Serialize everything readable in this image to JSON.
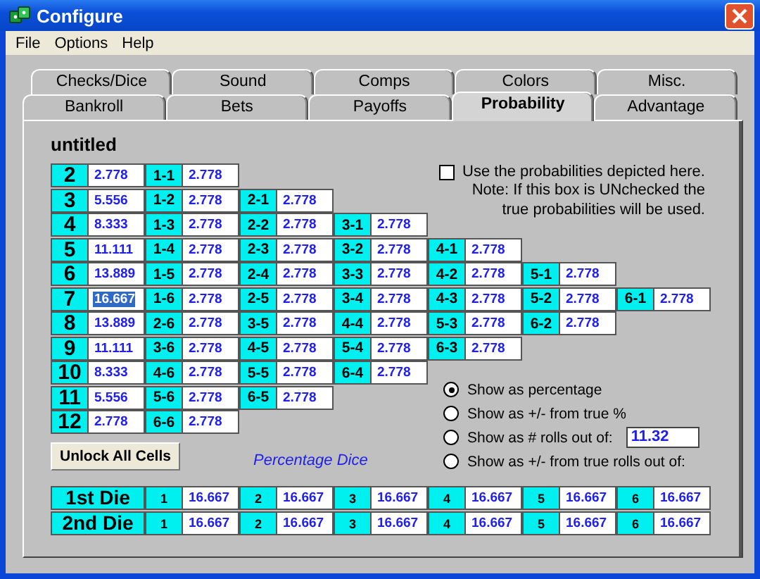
{
  "window": {
    "title": "Configure"
  },
  "menu": [
    "File",
    "Options",
    "Help"
  ],
  "tab_rows": [
    {
      "tabs": [
        {
          "label": "Checks/Dice",
          "selected": false
        },
        {
          "label": "Sound",
          "selected": false
        },
        {
          "label": "Comps",
          "selected": false
        },
        {
          "label": "Colors",
          "selected": false
        },
        {
          "label": "Misc.",
          "selected": false
        }
      ]
    },
    {
      "tabs": [
        {
          "label": "Bankroll",
          "selected": false
        },
        {
          "label": "Bets",
          "selected": false
        },
        {
          "label": "Payoffs",
          "selected": false
        },
        {
          "label": "Probability",
          "selected": true
        },
        {
          "label": "Advantage",
          "selected": false
        }
      ]
    }
  ],
  "document_title": "untitled",
  "use_probabilities": {
    "label": "Use the probabilities depicted here.",
    "checked": false,
    "note": "Note:  If this box is UNchecked the true probabilities will be used."
  },
  "sums": [
    {
      "total": "2",
      "value": "2.778",
      "selected": false,
      "combos": [
        {
          "label": "1-1",
          "value": "2.778"
        }
      ]
    },
    {
      "total": "3",
      "value": "5.556",
      "selected": false,
      "combos": [
        {
          "label": "1-2",
          "value": "2.778"
        },
        {
          "label": "2-1",
          "value": "2.778"
        }
      ]
    },
    {
      "total": "4",
      "value": "8.333",
      "selected": false,
      "combos": [
        {
          "label": "1-3",
          "value": "2.778"
        },
        {
          "label": "2-2",
          "value": "2.778"
        },
        {
          "label": "3-1",
          "value": "2.778"
        }
      ]
    },
    {
      "total": "5",
      "value": "11.111",
      "selected": false,
      "combos": [
        {
          "label": "1-4",
          "value": "2.778"
        },
        {
          "label": "2-3",
          "value": "2.778"
        },
        {
          "label": "3-2",
          "value": "2.778"
        },
        {
          "label": "4-1",
          "value": "2.778"
        }
      ]
    },
    {
      "total": "6",
      "value": "13.889",
      "selected": false,
      "combos": [
        {
          "label": "1-5",
          "value": "2.778"
        },
        {
          "label": "2-4",
          "value": "2.778"
        },
        {
          "label": "3-3",
          "value": "2.778"
        },
        {
          "label": "4-2",
          "value": "2.778"
        },
        {
          "label": "5-1",
          "value": "2.778"
        }
      ]
    },
    {
      "total": "7",
      "value": "16.667",
      "selected": true,
      "combos": [
        {
          "label": "1-6",
          "value": "2.778"
        },
        {
          "label": "2-5",
          "value": "2.778"
        },
        {
          "label": "3-4",
          "value": "2.778"
        },
        {
          "label": "4-3",
          "value": "2.778"
        },
        {
          "label": "5-2",
          "value": "2.778"
        },
        {
          "label": "6-1",
          "value": "2.778"
        }
      ]
    },
    {
      "total": "8",
      "value": "13.889",
      "selected": false,
      "combos": [
        {
          "label": "2-6",
          "value": "2.778"
        },
        {
          "label": "3-5",
          "value": "2.778"
        },
        {
          "label": "4-4",
          "value": "2.778"
        },
        {
          "label": "5-3",
          "value": "2.778"
        },
        {
          "label": "6-2",
          "value": "2.778"
        }
      ]
    },
    {
      "total": "9",
      "value": "11.111",
      "selected": false,
      "combos": [
        {
          "label": "3-6",
          "value": "2.778"
        },
        {
          "label": "4-5",
          "value": "2.778"
        },
        {
          "label": "5-4",
          "value": "2.778"
        },
        {
          "label": "6-3",
          "value": "2.778"
        }
      ]
    },
    {
      "total": "10",
      "value": "8.333",
      "selected": false,
      "combos": [
        {
          "label": "4-6",
          "value": "2.778"
        },
        {
          "label": "5-5",
          "value": "2.778"
        },
        {
          "label": "6-4",
          "value": "2.778"
        }
      ]
    },
    {
      "total": "11",
      "value": "5.556",
      "selected": false,
      "combos": [
        {
          "label": "5-6",
          "value": "2.778"
        },
        {
          "label": "6-5",
          "value": "2.778"
        }
      ]
    },
    {
      "total": "12",
      "value": "2.778",
      "selected": false,
      "combos": [
        {
          "label": "6-6",
          "value": "2.778"
        }
      ]
    }
  ],
  "unlock_button": "Unlock All Cells",
  "dice_caption": "Percentage Dice",
  "display_options": [
    {
      "label": "Show as percentage",
      "selected": true
    },
    {
      "label": "Show as +/- from true %",
      "selected": false
    },
    {
      "label": "Show as # rolls out of:",
      "selected": false,
      "field": "11.32"
    },
    {
      "label": "Show as +/- from true rolls out of:",
      "selected": false
    }
  ],
  "dice": [
    {
      "label": "1st Die",
      "faces": [
        {
          "label": "1",
          "value": "16.667"
        },
        {
          "label": "2",
          "value": "16.667"
        },
        {
          "label": "3",
          "value": "16.667"
        },
        {
          "label": "4",
          "value": "16.667"
        },
        {
          "label": "5",
          "value": "16.667"
        },
        {
          "label": "6",
          "value": "16.667"
        }
      ]
    },
    {
      "label": "2nd Die",
      "faces": [
        {
          "label": "1",
          "value": "16.667"
        },
        {
          "label": "2",
          "value": "16.667"
        },
        {
          "label": "3",
          "value": "16.667"
        },
        {
          "label": "4",
          "value": "16.667"
        },
        {
          "label": "5",
          "value": "16.667"
        },
        {
          "label": "6",
          "value": "16.667"
        }
      ]
    }
  ]
}
